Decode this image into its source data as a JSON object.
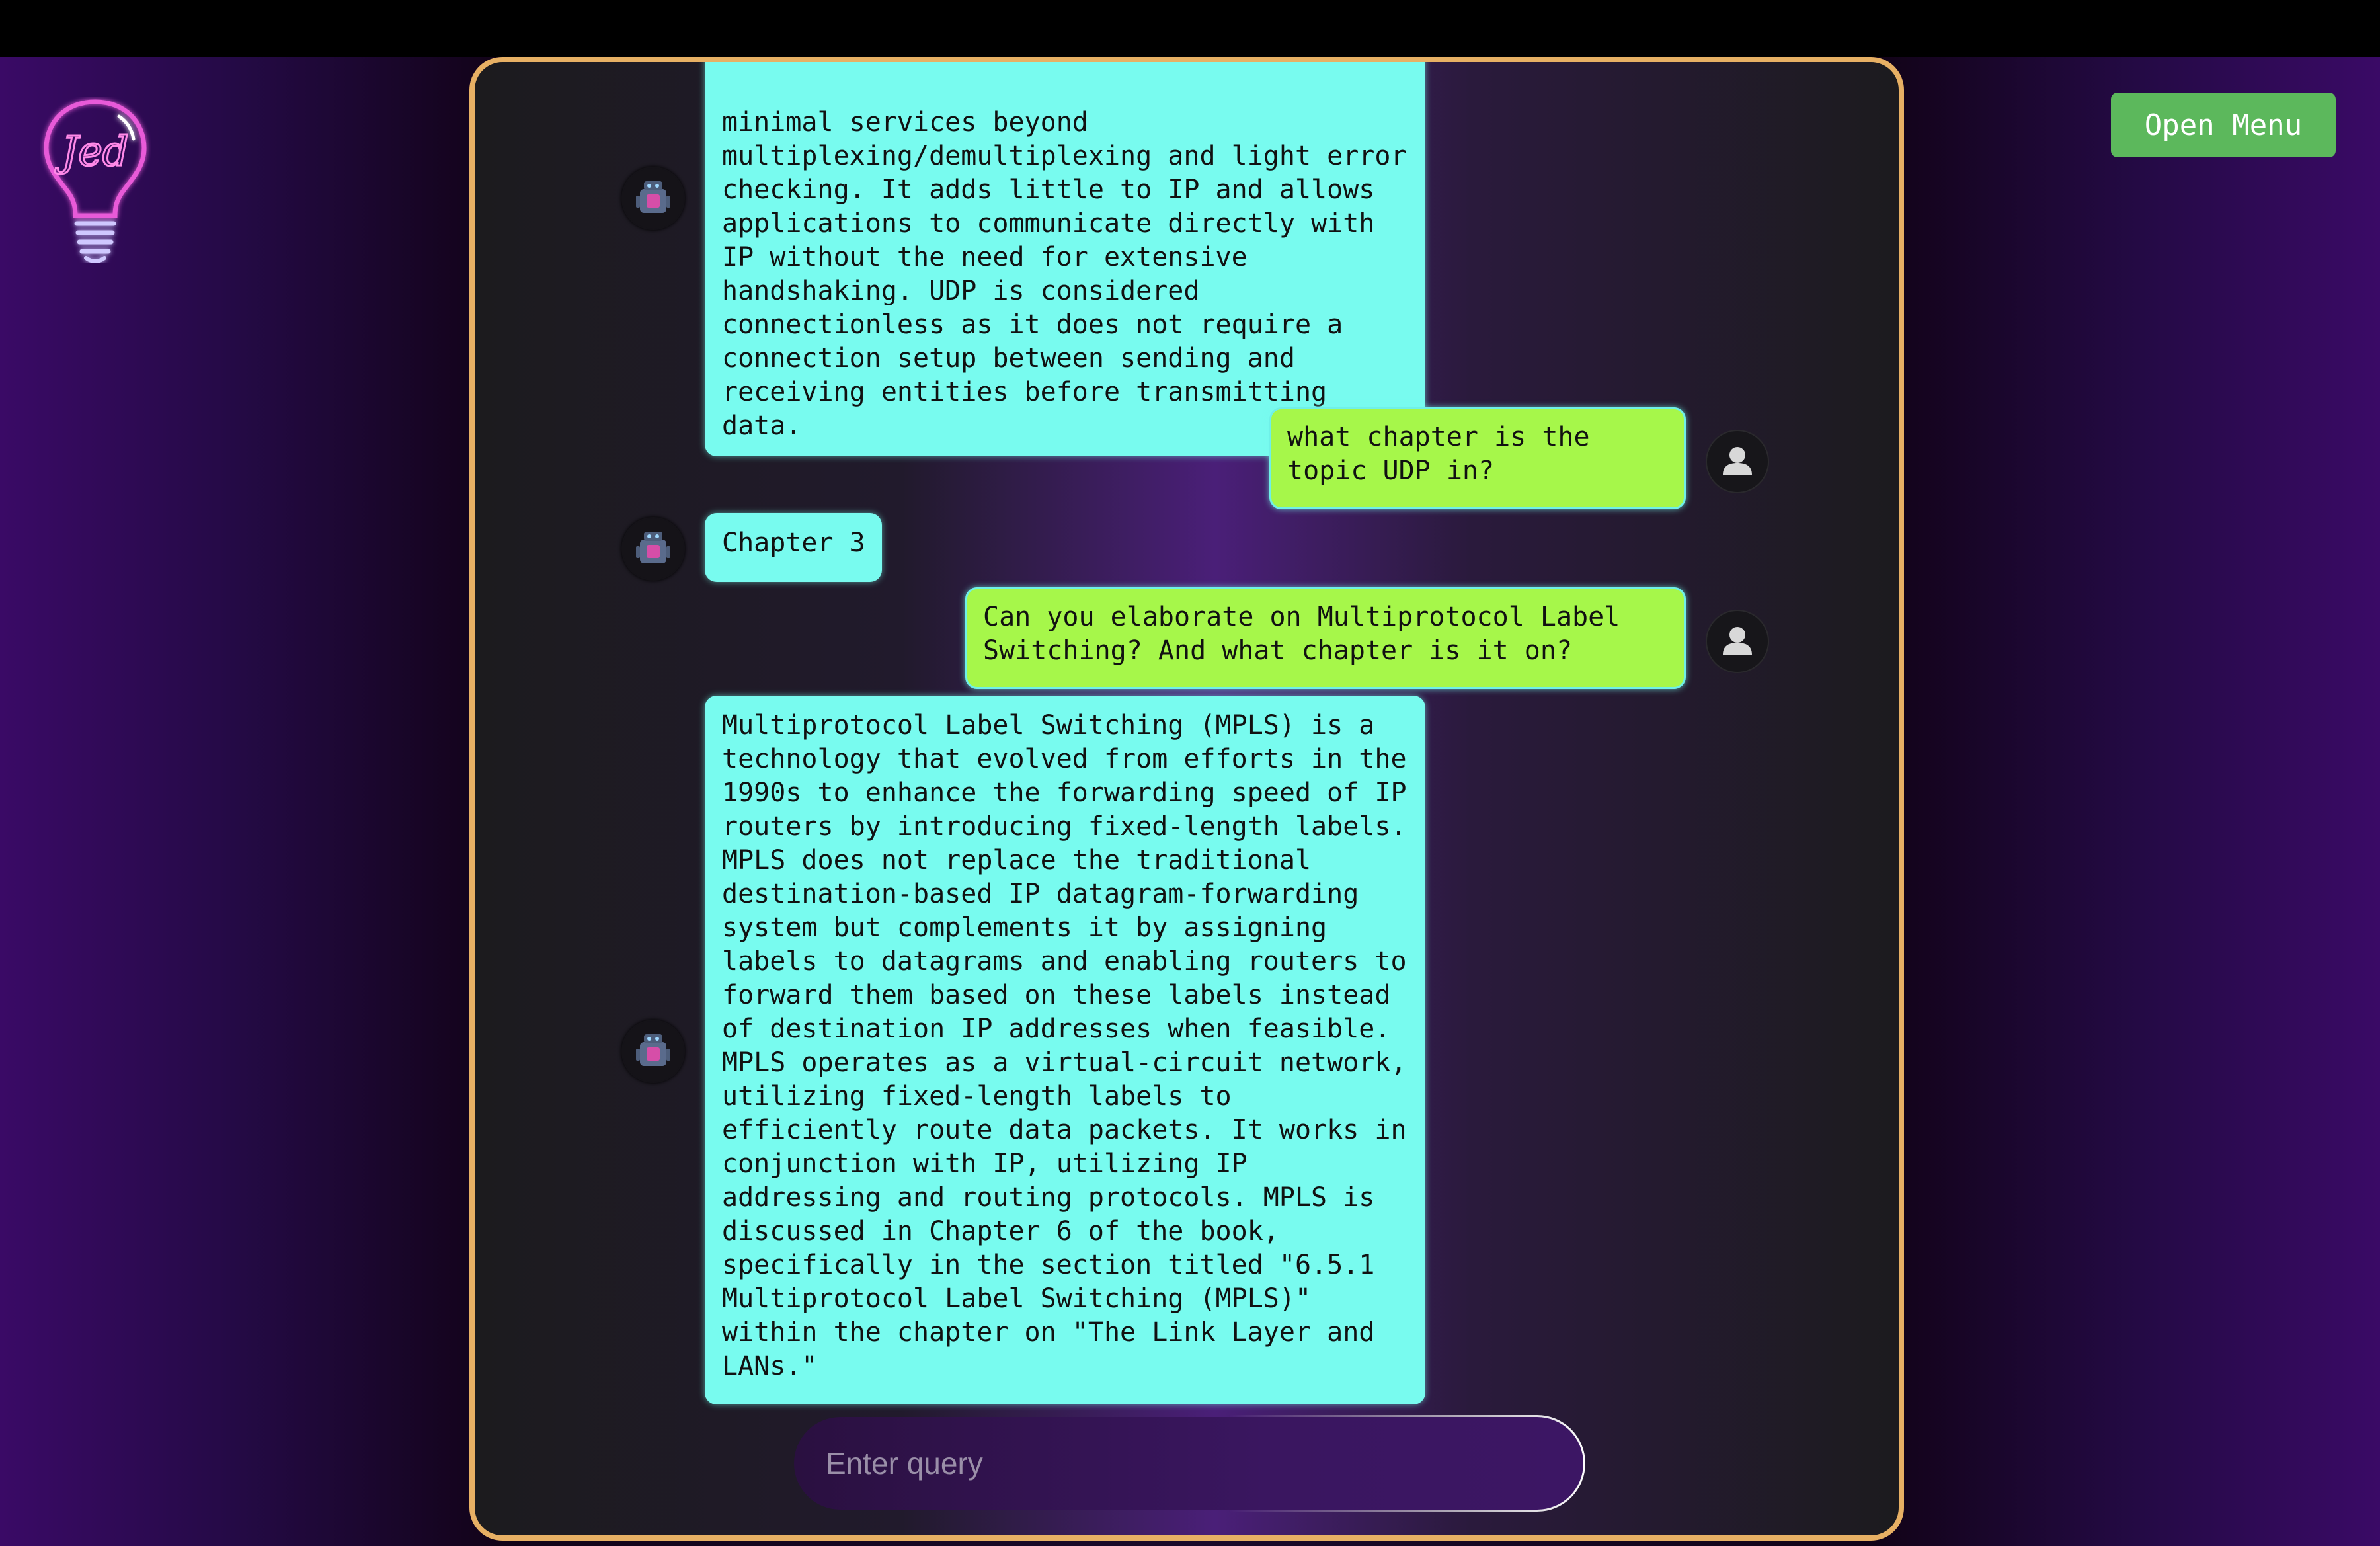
{
  "header": {
    "open_menu_label": "Open Menu"
  },
  "logo": {
    "text": "Jed"
  },
  "messages": [
    {
      "role": "bot",
      "text": "minimal services beyond\nmultiplexing/demultiplexing and light error\nchecking. It adds little to IP and allows\napplications to communicate directly with\nIP without the need for extensive\nhandshaking. UDP is considered\nconnectionless as it does not require a\nconnection setup between sending and\nreceiving entities before transmitting\ndata."
    },
    {
      "role": "user",
      "text": "what chapter is the\ntopic UDP in?"
    },
    {
      "role": "bot",
      "text": "Chapter 3"
    },
    {
      "role": "user",
      "text": "Can you elaborate on Multiprotocol Label\nSwitching? And what chapter is it on?"
    },
    {
      "role": "bot",
      "text": "Multiprotocol Label Switching (MPLS) is a\ntechnology that evolved from efforts in the\n1990s to enhance the forwarding speed of IP\nrouters by introducing fixed-length labels.\nMPLS does not replace the traditional\ndestination-based IP datagram-forwarding\nsystem but complements it by assigning\nlabels to datagrams and enabling routers to\nforward them based on these labels instead\nof destination IP addresses when feasible.\nMPLS operates as a virtual-circuit network,\nutilizing fixed-length labels to\nefficiently route data packets. It works in\nconjunction with IP, utilizing IP\naddressing and routing protocols. MPLS is\ndiscussed in Chapter 6 of the book,\nspecifically in the section titled \"6.5.1\nMultiprotocol Label Switching (MPLS)\"\nwithin the chapter on \"The Link Layer and\nLANs.\""
    }
  ],
  "query": {
    "placeholder": "Enter query",
    "value": ""
  },
  "icons": {
    "bot_avatar": "robot-icon",
    "user_avatar": "user-icon",
    "logo": "lightbulb-icon"
  },
  "colors": {
    "bot_bubble": "#78fbef",
    "user_bubble": "#a6f74a",
    "panel_border": "#e7b064",
    "menu_button": "#5cb85c"
  }
}
